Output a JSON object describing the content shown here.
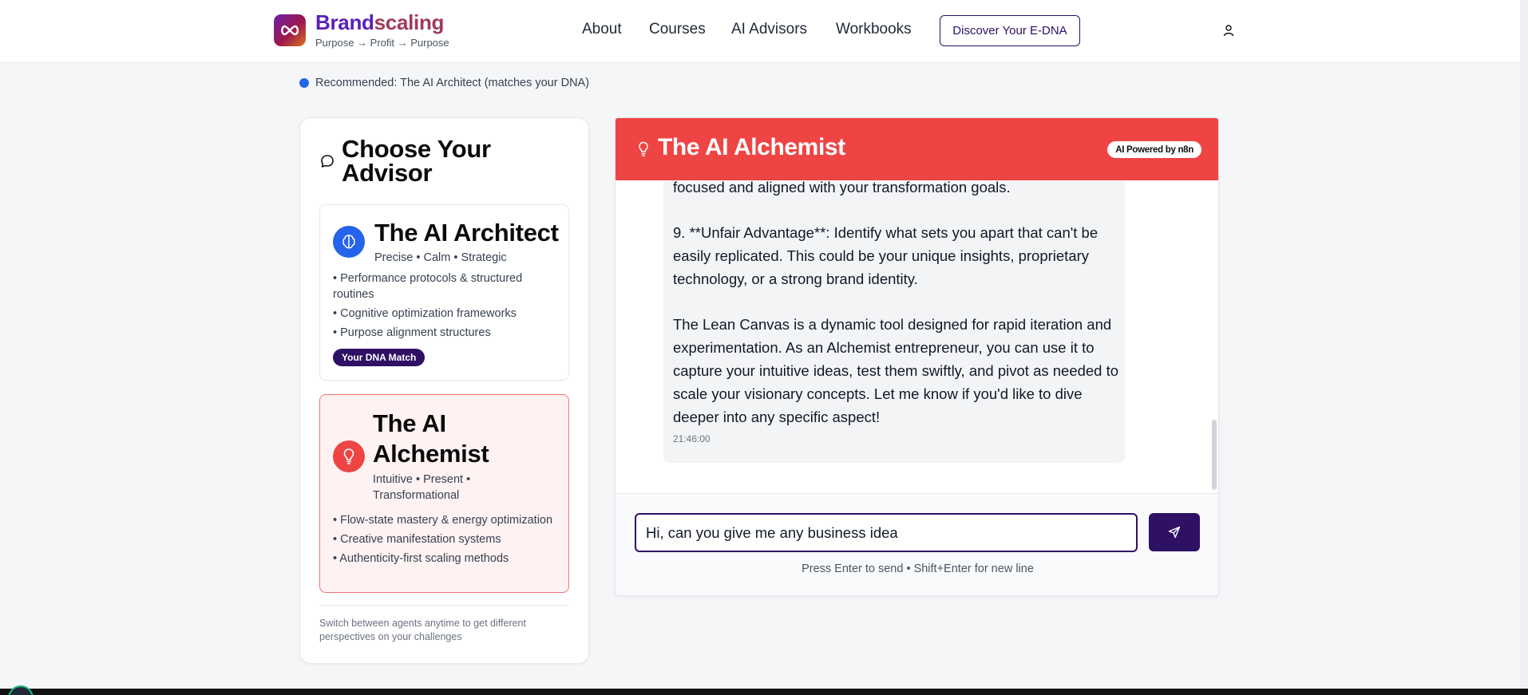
{
  "header": {
    "brand_name_a": "Brand",
    "brand_name_b": "scaling",
    "tagline": "Purpose → Profit → Purpose",
    "nav": [
      {
        "label": "About"
      },
      {
        "label": "Courses"
      },
      {
        "label": "AI Advisors"
      },
      {
        "label": "Workbooks"
      }
    ],
    "cta_label": "Discover Your E-DNA",
    "logo_icon": "infinity-icon",
    "user_icon": "user-icon"
  },
  "recommendation": "Recommended: The AI Architect (matches your DNA)",
  "advisor_panel": {
    "title": "Choose Your Advisor",
    "advisors": [
      {
        "name": "The AI Architect",
        "traits": "Precise • Calm • Strategic",
        "features": [
          "• Performance protocols & structured routines",
          "• Cognitive optimization frameworks",
          "• Purpose alignment structures"
        ],
        "badge": "Your DNA Match",
        "icon": "brain-icon",
        "color": "#2563eb"
      },
      {
        "name": "The AI Alchemist",
        "traits": "Intuitive • Present • Transformational",
        "features": [
          "• Flow-state mastery & energy optimization",
          "• Creative manifestation systems",
          "• Authenticity-first scaling methods"
        ],
        "icon": "lightbulb-icon",
        "color": "#ef4444"
      }
    ],
    "footnote": "Switch between agents anytime to get different perspectives on your challenges"
  },
  "chat": {
    "title": "The AI Alchemist",
    "powered_badge": "AI Powered by n8n",
    "message": {
      "p1": "focused and aligned with your transformation goals.",
      "p2": "9. **Unfair Advantage**: Identify what sets you apart that can't be easily replicated. This could be your unique insights, proprietary technology, or a strong brand identity.",
      "p3": "The Lean Canvas is a dynamic tool designed for rapid iteration and experimentation. As an Alchemist entrepreneur, you can use it to capture your intuitive ideas, test them swiftly, and pivot as needed to scale your visionary concepts. Let me know if you'd like to dive deeper into any specific aspect!",
      "timestamp": "21:46:00"
    },
    "input_value": "Hi, can you give me any business idea",
    "hint": "Press Enter to send • Shift+Enter for new line",
    "header_color": "#ef4444",
    "accent_color": "#2e1065"
  }
}
